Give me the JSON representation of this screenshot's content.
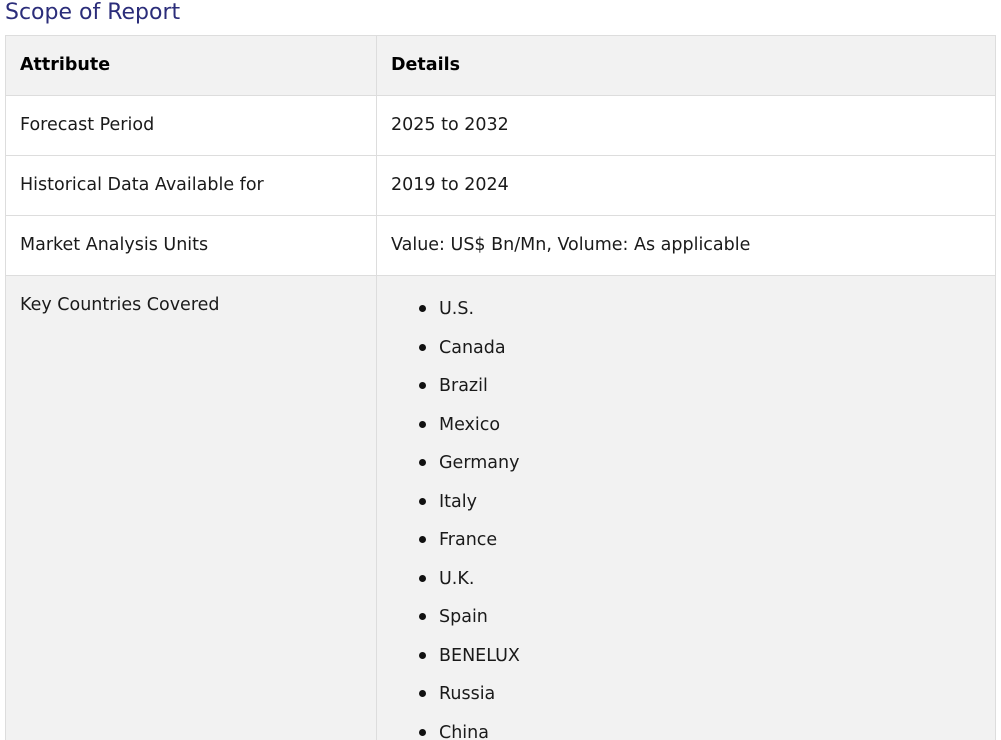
{
  "title": "Scope of Report",
  "table": {
    "headers": {
      "attribute": "Attribute",
      "details": "Details"
    },
    "rows": [
      {
        "attribute": "Forecast Period",
        "details": "2025 to 2032"
      },
      {
        "attribute": "Historical Data Available for",
        "details": "2019 to 2024"
      },
      {
        "attribute": "Market Analysis Units",
        "details": "Value: US$ Bn/Mn, Volume: As applicable"
      }
    ],
    "countries_row": {
      "attribute": "Key Countries Covered",
      "countries": [
        "U.S.",
        "Canada",
        "Brazil",
        "Mexico",
        "Germany",
        "Italy",
        "France",
        "U.K.",
        "Spain",
        "BENELUX",
        "Russia",
        "China"
      ]
    }
  }
}
